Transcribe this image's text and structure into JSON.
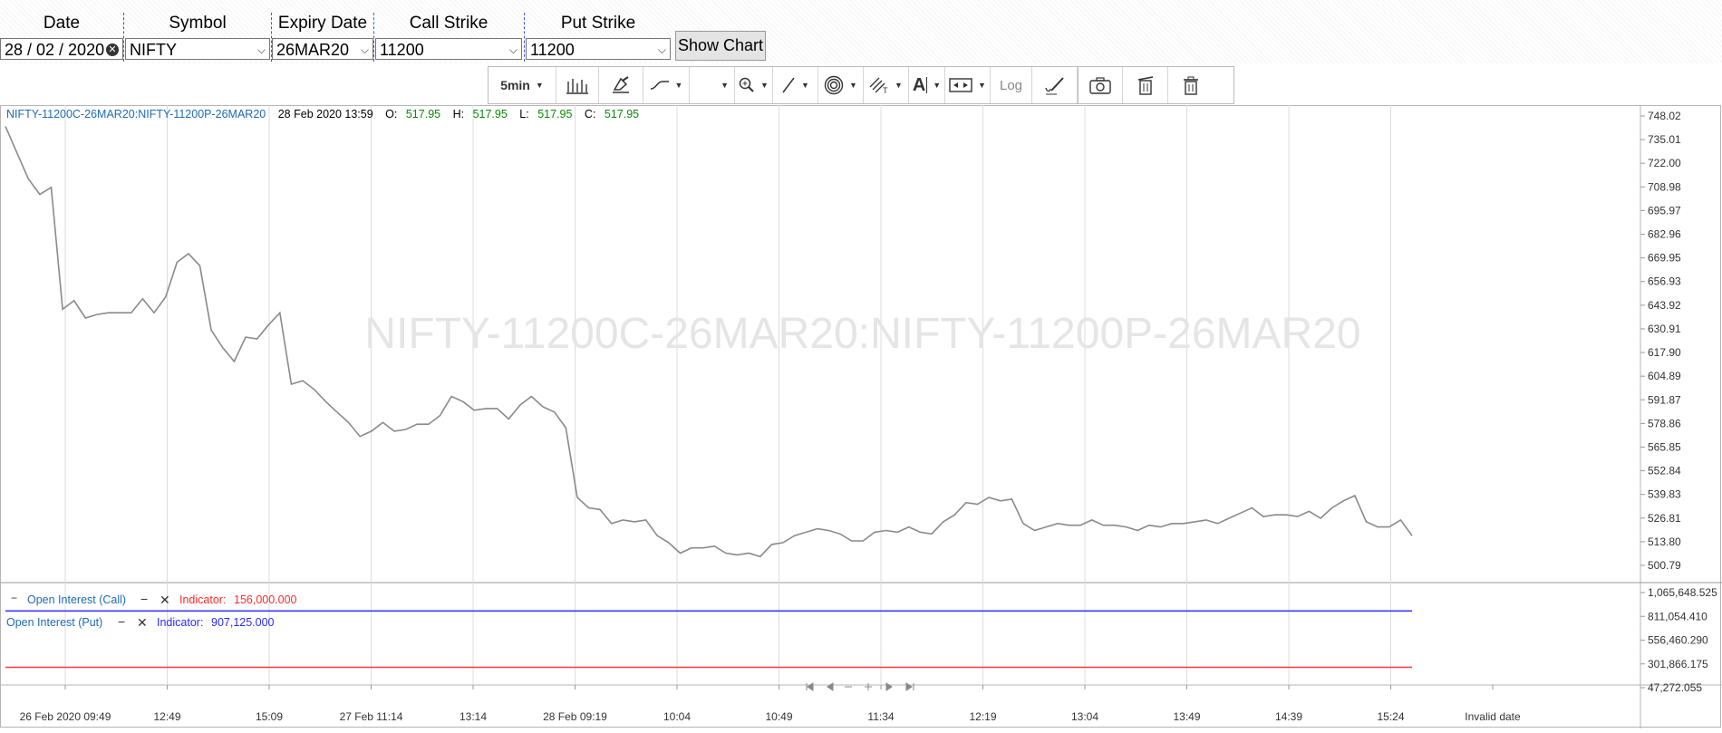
{
  "form": {
    "headers": {
      "date": "Date",
      "symbol": "Symbol",
      "expiry": "Expiry Date",
      "call": "Call Strike",
      "put": "Put Strike"
    },
    "date_value": "28 / 02 / 2020",
    "symbol_value": "NIFTY",
    "expiry_value": "26MAR20",
    "call_value": "11200",
    "put_value": "11200",
    "show_chart": "Show Chart"
  },
  "toolbar": {
    "interval": "5min",
    "log": "Log",
    "icons": [
      "bar-chart-icon",
      "paint-icon",
      "line-style-icon",
      "blank-select",
      "zoom-icon",
      "trendline-icon",
      "target-icon",
      "fib-icon",
      "text-icon",
      "measure-icon",
      "log-button",
      "pen-icon",
      "camera-icon",
      "delete-icon",
      "trash-icon"
    ]
  },
  "chart": {
    "legend_symbol": "NIFTY-11200C-26MAR20:NIFTY-11200P-26MAR20",
    "legend_datetime": "28 Feb 2020 13:59",
    "o_label": "O:",
    "o_value": "517.95",
    "h_label": "H:",
    "h_value": "517.95",
    "l_label": "L:",
    "l_value": "517.95",
    "c_label": "C:",
    "c_value": "517.95",
    "watermark": "NIFTY-11200C-26MAR20:NIFTY-11200P-26MAR20",
    "ind1_label": "Open Interest (Call)",
    "ind1_ind_label": "Indicator:",
    "ind1_value": "156,000.000",
    "ind2_label": "Open Interest (Put)",
    "ind2_ind_label": "Indicator:",
    "ind2_value": "907,125.000",
    "colors": {
      "price": "#8a8a8a",
      "call": "#ff3b3b",
      "put": "#3b3bff",
      "legend_blue": "#1e6bb8",
      "ohlc_green": "#0a8a0a"
    }
  },
  "chart_data": {
    "type": "line",
    "x_ticks": [
      "26 Feb 2020 09:49",
      "12:49",
      "15:09",
      "27 Feb 11:14",
      "13:14",
      "28 Feb 09:19",
      "10:04",
      "10:49",
      "11:34",
      "12:19",
      "13:04",
      "13:49",
      "14:39",
      "15:24",
      "Invalid date"
    ],
    "price_axis_ticks": [
      "748.02",
      "735.01",
      "722.00",
      "708.98",
      "695.97",
      "682.96",
      "669.95",
      "656.93",
      "643.92",
      "630.91",
      "617.90",
      "604.89",
      "591.87",
      "578.86",
      "565.85",
      "552.84",
      "539.83",
      "526.81",
      "513.80",
      "500.79"
    ],
    "price_ylim": [
      495.0,
      752.0
    ],
    "oi_axis_ticks": [
      "1,065,648.525",
      "811,054.410",
      "556,460.290",
      "301,866.175",
      "47,272.055"
    ],
    "oi_ylim": [
      -80000,
      1165000
    ],
    "series": [
      {
        "values": [
          746,
          731,
          716,
          707,
          711,
          641,
          646,
          636,
          638,
          639,
          639,
          639,
          647,
          639,
          648,
          668,
          673,
          666,
          629,
          619,
          611,
          625,
          624,
          632,
          639,
          598,
          600,
          595,
          588,
          582,
          576,
          568,
          571,
          576,
          571,
          572,
          575,
          575,
          580,
          591,
          588,
          583,
          584,
          584,
          578,
          586,
          591,
          585,
          582,
          573,
          533,
          527,
          526,
          518,
          520,
          519,
          520,
          511,
          507,
          501,
          504,
          504,
          505,
          501,
          500,
          501,
          499,
          506,
          507,
          511,
          513,
          515,
          514,
          512,
          508,
          508,
          513,
          514,
          513,
          516,
          513,
          512,
          519,
          523,
          530,
          529,
          533,
          531,
          532,
          518,
          514,
          516,
          518,
          517,
          517,
          520,
          517,
          517,
          516,
          514,
          517,
          516,
          518,
          518,
          519,
          520,
          518,
          521,
          524,
          527,
          522,
          523,
          523,
          522,
          525,
          521,
          527,
          531,
          534,
          519,
          516,
          516,
          520,
          511
        ]
      },
      {
        "name": "Open Interest (Call)",
        "values": [
          156000,
          156000,
          156000,
          156000,
          156000,
          156000,
          156000,
          156000,
          156000,
          156000,
          156000,
          156000,
          156000,
          156000,
          156000,
          156000,
          156000,
          156000,
          156000,
          156000,
          156000,
          156000,
          156000,
          156000,
          156000,
          156000,
          156000,
          156000,
          156000,
          156000,
          156000,
          156000,
          156000,
          156000,
          156000,
          156000,
          156000,
          156000,
          156000,
          156000,
          156000,
          156000,
          156000,
          156000,
          156000,
          156000,
          156000,
          156000,
          156000,
          156000,
          156000,
          156000,
          156000,
          156000,
          156000,
          156000,
          156000,
          156000,
          156000,
          156000,
          156000,
          156000,
          156000,
          156000,
          156000,
          156000,
          156000,
          156000,
          156000,
          156000,
          156000,
          156000,
          156000,
          156000,
          156000,
          156000,
          156000,
          156000,
          156000,
          156000,
          156000,
          156000,
          156000,
          156000,
          156000,
          156000,
          156000,
          156000,
          156000,
          156000,
          156000,
          156000,
          156000,
          156000,
          156000,
          156000,
          156000,
          156000,
          156000,
          156000,
          156000,
          156000,
          156000,
          156000,
          156000,
          156000,
          156000,
          156000,
          156000,
          156000,
          156000,
          156000,
          156000,
          156000,
          156000,
          156000,
          156000,
          156000,
          156000,
          156000,
          156000,
          156000,
          156000,
          156000
        ]
      },
      {
        "name": "Open Interest (Put)",
        "values": [
          907125,
          907125,
          907125,
          907125,
          907125,
          907125,
          907125,
          907125,
          907125,
          907125,
          907125,
          907125,
          907125,
          907125,
          907125,
          907125,
          907125,
          907125,
          907125,
          907125,
          907125,
          907125,
          907125,
          907125,
          907125,
          907125,
          907125,
          907125,
          907125,
          907125,
          907125,
          907125,
          907125,
          907125,
          907125,
          907125,
          907125,
          907125,
          907125,
          907125,
          907125,
          907125,
          907125,
          907125,
          907125,
          907125,
          907125,
          907125,
          907125,
          907125,
          907125,
          907125,
          907125,
          907125,
          907125,
          907125,
          907125,
          907125,
          907125,
          907125,
          907125,
          907125,
          907125,
          907125,
          907125,
          907125,
          907125,
          907125,
          907125,
          907125,
          907125,
          907125,
          907125,
          907125,
          907125,
          907125,
          907125,
          907125,
          907125,
          907125,
          907125,
          907125,
          907125,
          907125,
          907125,
          907125,
          907125,
          907125,
          907125,
          907125,
          907125,
          907125,
          907125,
          907125,
          907125,
          907125,
          907125,
          907125,
          907125,
          907125,
          907125,
          907125,
          907125,
          907125,
          907125,
          907125,
          907125,
          907125,
          907125,
          907125,
          907125,
          907125,
          907125,
          907125,
          907125,
          907125,
          907125,
          907125,
          907125,
          907125,
          907125,
          907125,
          907125,
          907125
        ]
      }
    ]
  }
}
